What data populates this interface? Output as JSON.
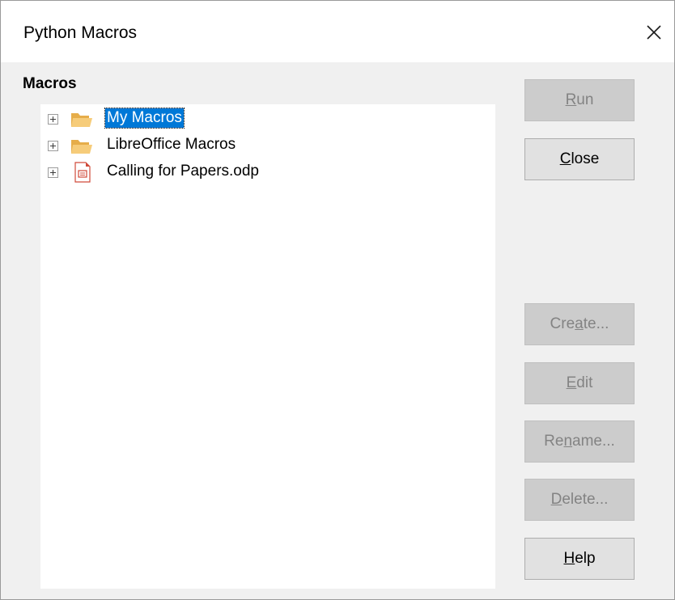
{
  "window": {
    "title": "Python Macros",
    "close_glyph": "✕"
  },
  "macros": {
    "label": "Macros",
    "tree": [
      {
        "label": "My Macros",
        "icon": "folder-icon",
        "selected": true
      },
      {
        "label": "LibreOffice Macros",
        "icon": "folder-icon",
        "selected": false
      },
      {
        "label": "Calling for Papers.odp",
        "icon": "impress-document-icon",
        "selected": false
      }
    ]
  },
  "buttons": {
    "run": {
      "pre": "",
      "mn": "R",
      "post": "un",
      "enabled": false
    },
    "close": {
      "pre": "",
      "mn": "C",
      "post": "lose",
      "enabled": true
    },
    "create": {
      "pre": "Cre",
      "mn": "a",
      "post": "te...",
      "enabled": false
    },
    "edit": {
      "pre": "",
      "mn": "E",
      "post": "dit",
      "enabled": false
    },
    "rename": {
      "pre": "Re",
      "mn": "n",
      "post": "ame...",
      "enabled": false
    },
    "delete": {
      "pre": "",
      "mn": "D",
      "post": "elete...",
      "enabled": false
    },
    "help": {
      "pre": "",
      "mn": "H",
      "post": "elp",
      "enabled": true
    }
  },
  "colors": {
    "selection": "#0078d7",
    "folder": "#f2c46a",
    "document_accent": "#d04a3a"
  }
}
